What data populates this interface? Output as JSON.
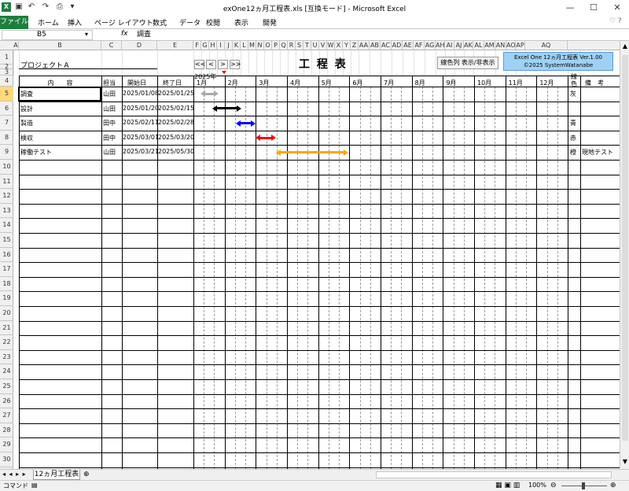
{
  "window": {
    "title": "exOne12ヵ月工程表.xls [互換モード] - Microsoft Excel",
    "min": "—",
    "max": "☐",
    "close": "✕"
  },
  "ribbon": {
    "tabs": [
      "ファイル",
      "ホーム",
      "挿入",
      "ページ レイアウト",
      "数式",
      "データ",
      "校閲",
      "表示",
      "開発"
    ]
  },
  "formula_bar": {
    "name_box": "B5",
    "fx": "fx",
    "value": "調査"
  },
  "columns": [
    "A",
    "B",
    "C",
    "D",
    "E",
    "F",
    "G",
    "H",
    "I",
    "J",
    "K",
    "L",
    "M",
    "N",
    "O",
    "P",
    "Q",
    "R",
    "S",
    "T",
    "U",
    "V",
    "W",
    "X",
    "Y",
    "Z",
    "AA",
    "AB",
    "AC",
    "AD",
    "AE",
    "AF",
    "AG",
    "AH",
    "AI",
    "AJ",
    "AK",
    "AL",
    "AM",
    "AN",
    "AO",
    "AP",
    "AQ"
  ],
  "sheet": {
    "project": "プロジェクトＡ",
    "title": "工 程 表",
    "year": "2025年",
    "nav_buttons": [
      "<<",
      "<",
      ">",
      ">>"
    ],
    "toggle_button": "線色列 表示/非表示",
    "info_box": {
      "line1": "Excel One 12ヵ月工程表 Ver.1.00",
      "line2": "©2025 SystemWatanabe"
    },
    "headers": {
      "content": "内　　容",
      "person": "担当",
      "start": "開始日",
      "end": "終了日",
      "color": "線色",
      "note": "備　考"
    },
    "months": [
      "1月",
      "2月",
      "3月",
      "4月",
      "5月",
      "6月",
      "7月",
      "8月",
      "9月",
      "10月",
      "11月",
      "12月"
    ],
    "tasks": [
      {
        "content": "調査",
        "person": "山田",
        "start": "2025/01/08",
        "end": "2025/01/25",
        "color": "灰",
        "note": ""
      },
      {
        "content": "設計",
        "person": "山田",
        "start": "2025/01/20",
        "end": "2025/02/15",
        "color": "",
        "note": ""
      },
      {
        "content": "製造",
        "person": "田中",
        "start": "2025/02/11",
        "end": "2025/02/28",
        "color": "青",
        "note": ""
      },
      {
        "content": "検収",
        "person": "田中",
        "start": "2025/03/01",
        "end": "2025/03/20",
        "color": "赤",
        "note": ""
      },
      {
        "content": "稼働テスト",
        "person": "山田",
        "start": "2025/03/21",
        "end": "2025/05/30",
        "color": "橙",
        "note": "現地テスト"
      }
    ],
    "bar_colors": [
      "#aaaaaa",
      "#000000",
      "#0000ff",
      "#ff0000",
      "#ffa500"
    ]
  },
  "sheet_tabs": {
    "active": "12ヵ月工程表"
  },
  "status": {
    "mode": "コマンド",
    "zoom": "100%"
  }
}
